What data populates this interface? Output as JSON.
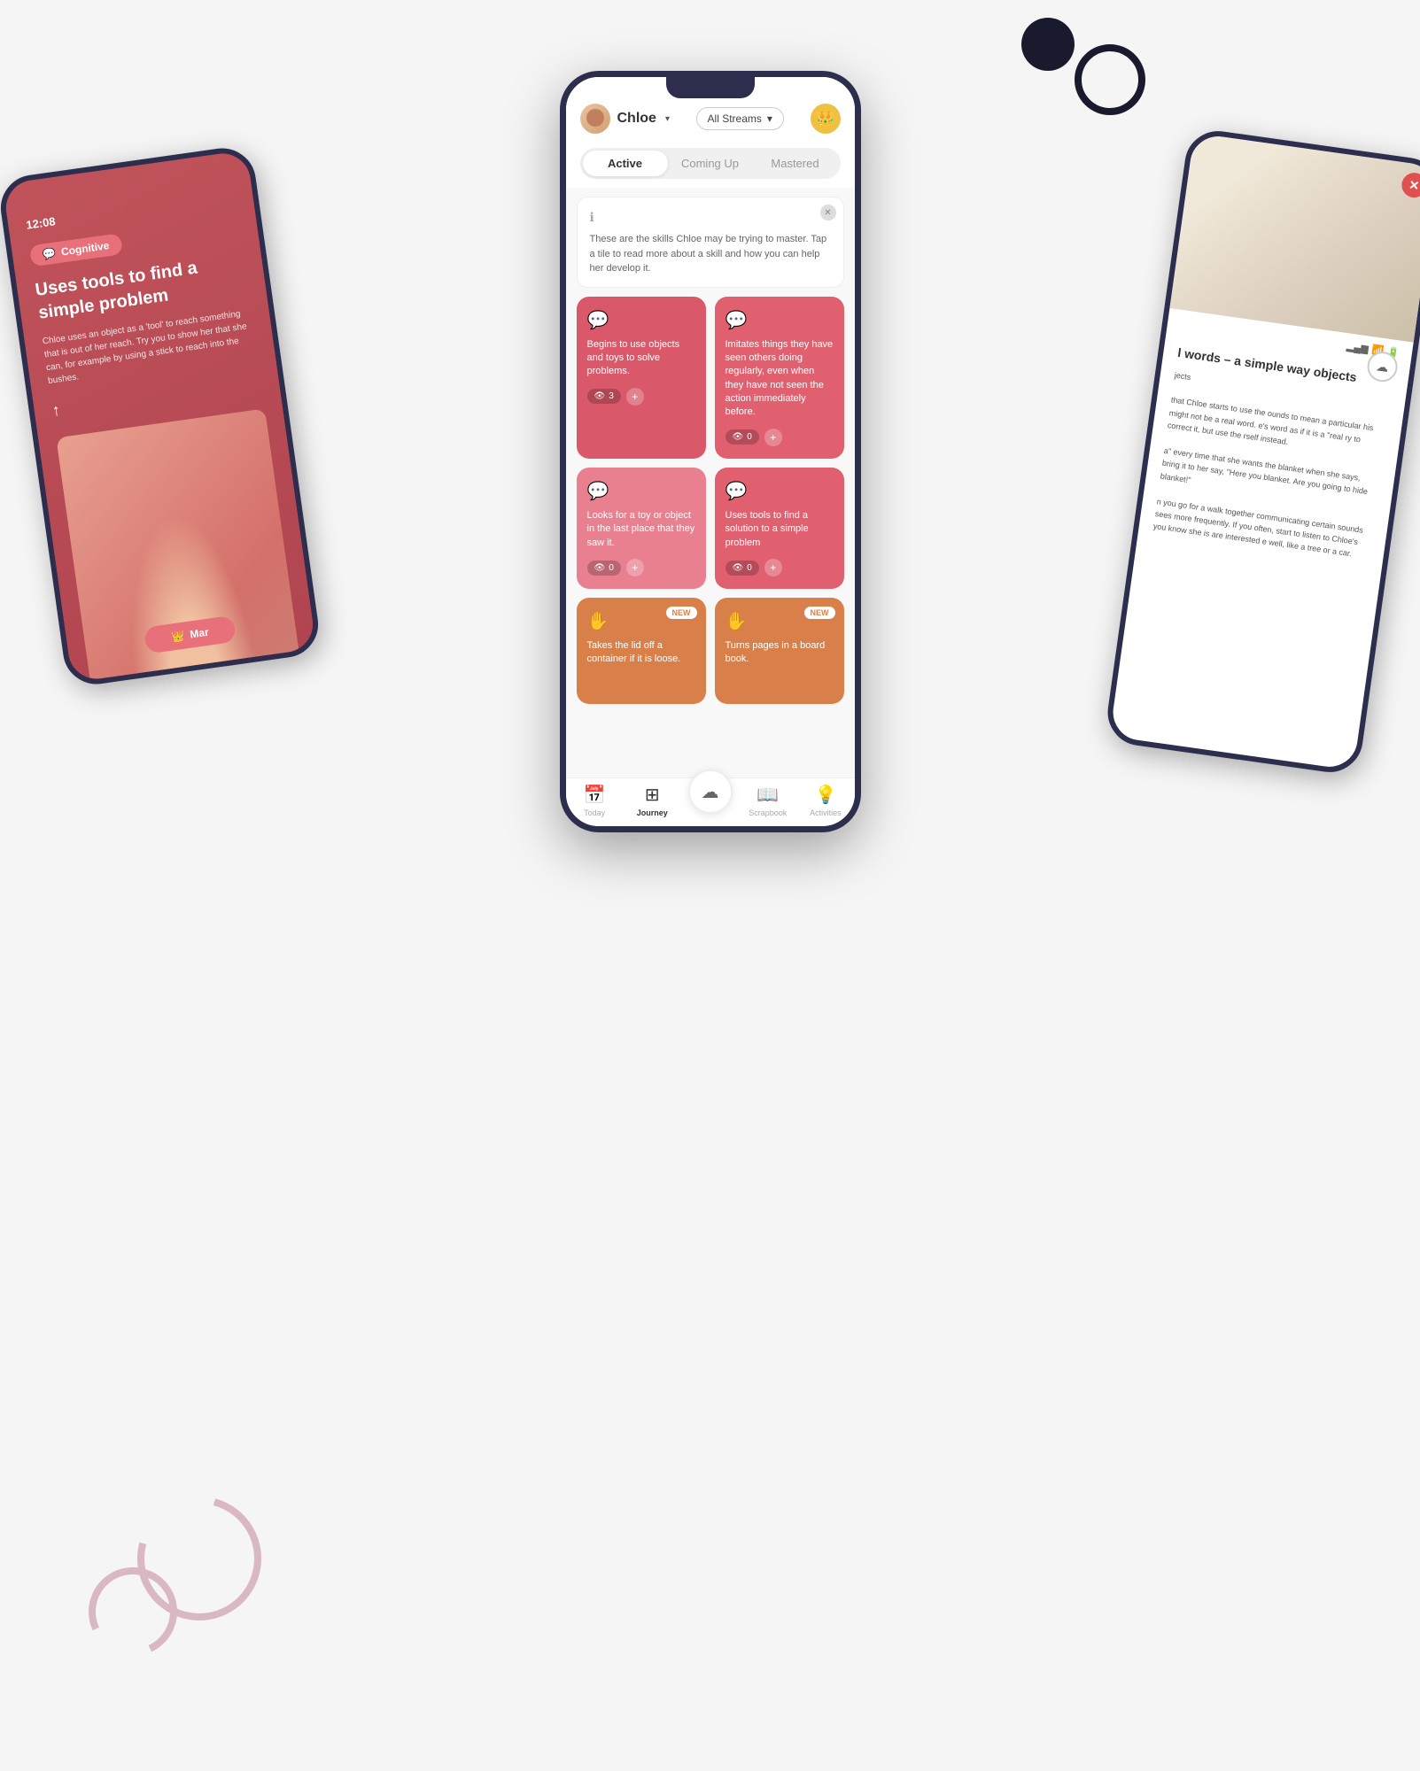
{
  "decorative": {
    "circle_black": "●",
    "circle_outline": "○"
  },
  "left_phone": {
    "time": "12:08",
    "badge": "Cognitive",
    "title": "Uses tools to find a simple problem",
    "description": "Chloe uses an object as a 'tool' to reach something that is out of her reach. Try you to show her that she can, for example by using a stick to reach into the bushes.",
    "share_icon": "↑",
    "btn_label": "Mar"
  },
  "right_phone": {
    "close_icon": "✕",
    "cloud_icon": "☁",
    "article_title": "l words – a simple way objects",
    "article_sections": [
      "jects",
      "that Chloe starts to use the ounds to mean a particular his might not be a real word. e's word as if it is a \"real ry to correct it, but use the rself instead.",
      "a\" every time that she wants the blanket when she says, bring it to her say, \"Here you blanket. Are you going to hide blanket!\"",
      "n you go for a walk together communicating certain sounds sees more frequently. If you often, start to listen to Chloe's you know she is are interested e well, like a tree or a car."
    ]
  },
  "center_phone": {
    "header": {
      "user_name": "Chloe",
      "dropdown_label": "▾",
      "streams_label": "All Streams",
      "streams_arrow": "▾",
      "crown_icon": "👑"
    },
    "tabs": [
      {
        "label": "Active",
        "active": true
      },
      {
        "label": "Coming Up",
        "active": false
      },
      {
        "label": "Mastered",
        "active": false
      }
    ],
    "info_banner": {
      "icon": "ℹ",
      "text": "These are the skills Chloe may be trying to master. Tap a tile to read more about a skill and how you can help her develop it.",
      "close": "✕"
    },
    "skills": [
      {
        "id": "skill-1",
        "icon": "💬",
        "text": "Begins to use objects and toys to solve problems.",
        "eye_count": 3,
        "color": "pink-dark",
        "new": false
      },
      {
        "id": "skill-2",
        "icon": "💬",
        "text": "Imitates things they have seen others doing regularly, even when they have not seen the action immediately before.",
        "eye_count": 0,
        "color": "pink-medium",
        "new": false
      },
      {
        "id": "skill-3",
        "icon": "💬",
        "text": "Looks for a toy or object in the last place that they saw it.",
        "eye_count": 0,
        "color": "pink-light",
        "new": false
      },
      {
        "id": "skill-4",
        "icon": "💬",
        "text": "Uses tools to find a solution to a simple problem",
        "eye_count": 0,
        "color": "pink-medium",
        "new": false
      },
      {
        "id": "skill-5",
        "icon": "✋",
        "text": "Takes the lid off a container if it is loose.",
        "eye_count": null,
        "color": "coral",
        "new": true
      },
      {
        "id": "skill-6",
        "icon": "✋",
        "text": "Turns pages in a board book.",
        "eye_count": null,
        "color": "coral-new",
        "new": true
      }
    ],
    "bottom_nav": [
      {
        "id": "today",
        "icon": "📅",
        "label": "Today",
        "active": false
      },
      {
        "id": "journey",
        "icon": "⊞",
        "label": "Journey",
        "active": true
      },
      {
        "id": "upload",
        "icon": "☁",
        "label": "",
        "active": false,
        "center": true
      },
      {
        "id": "scrapbook",
        "icon": "📖",
        "label": "Scrapbook",
        "active": false
      },
      {
        "id": "activities",
        "icon": "💡",
        "label": "Activities",
        "active": false
      }
    ]
  }
}
